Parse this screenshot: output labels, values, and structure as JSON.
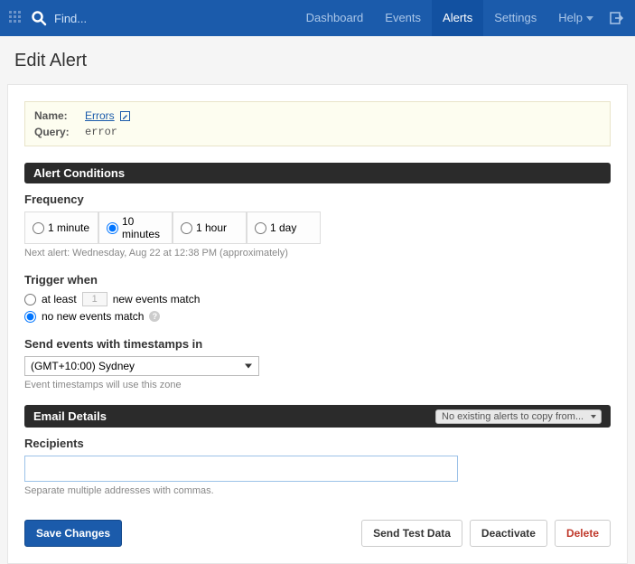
{
  "nav": {
    "search_placeholder": "Find...",
    "items": [
      "Dashboard",
      "Events",
      "Alerts",
      "Settings",
      "Help"
    ],
    "active_index": 2
  },
  "page_title": "Edit Alert",
  "meta": {
    "name_label": "Name:",
    "name_value": "Errors",
    "query_label": "Query:",
    "query_value": "error"
  },
  "sections": {
    "conditions_title": "Alert Conditions",
    "email_title": "Email Details",
    "copy_from_placeholder": "No existing alerts to copy from..."
  },
  "frequency": {
    "label": "Frequency",
    "options": [
      "1 minute",
      "10 minutes",
      "1 hour",
      "1 day"
    ],
    "selected_index": 1,
    "next_alert_hint": "Next alert: Wednesday, Aug 22 at 12:38 PM (approximately)"
  },
  "trigger": {
    "label": "Trigger when",
    "at_least_prefix": "at least",
    "at_least_value": "1",
    "at_least_suffix": "new events match",
    "no_new_label": "no new events match",
    "selected": "no_new"
  },
  "timezone": {
    "label": "Send events with timestamps in",
    "value": "(GMT+10:00) Sydney",
    "hint": "Event timestamps will use this zone"
  },
  "recipients": {
    "label": "Recipients",
    "value": "",
    "hint": "Separate multiple addresses with commas."
  },
  "buttons": {
    "save": "Save Changes",
    "send_test": "Send Test Data",
    "deactivate": "Deactivate",
    "delete": "Delete"
  }
}
